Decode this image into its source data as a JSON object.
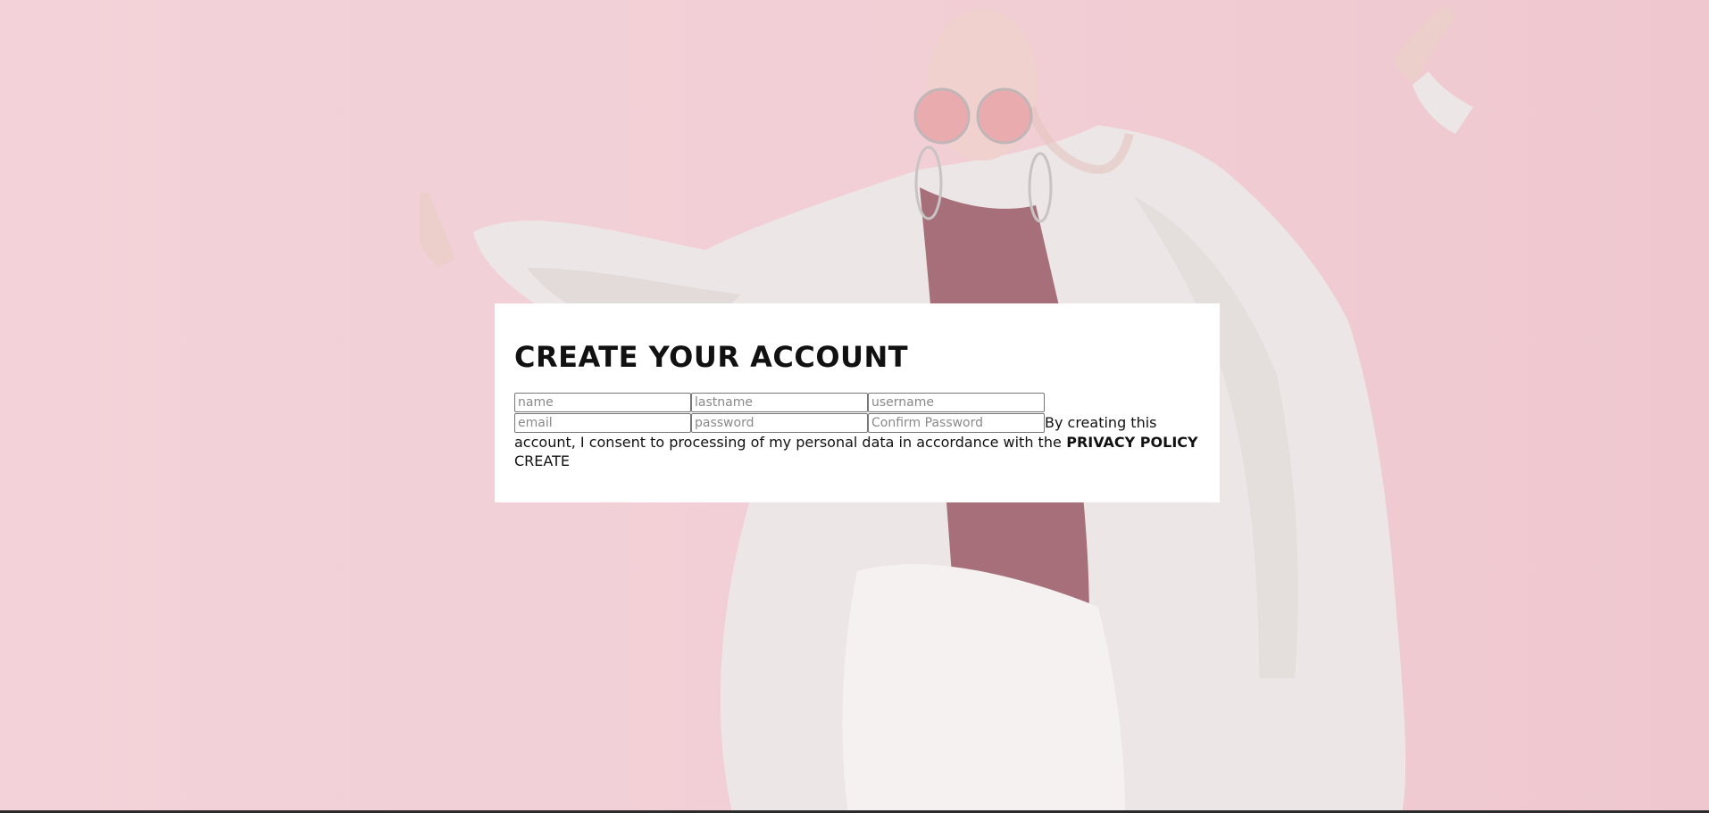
{
  "page": {
    "background_color": "#f2cfd6"
  },
  "form": {
    "title": "CREATE YOUR ACCOUNT",
    "fields": {
      "name": {
        "placeholder": "name",
        "value": ""
      },
      "lastname": {
        "placeholder": "lastname",
        "value": ""
      },
      "username": {
        "placeholder": "username",
        "value": ""
      },
      "email": {
        "placeholder": "email",
        "value": ""
      },
      "password": {
        "placeholder": "password",
        "value": ""
      },
      "confirm_password": {
        "placeholder": "Confirm Password",
        "value": ""
      }
    },
    "consent_text": "By creating this account, I consent to processing of my personal data in accordance with the",
    "privacy_link": "PRIVACY POLICY",
    "submit_label": "CREATE"
  }
}
